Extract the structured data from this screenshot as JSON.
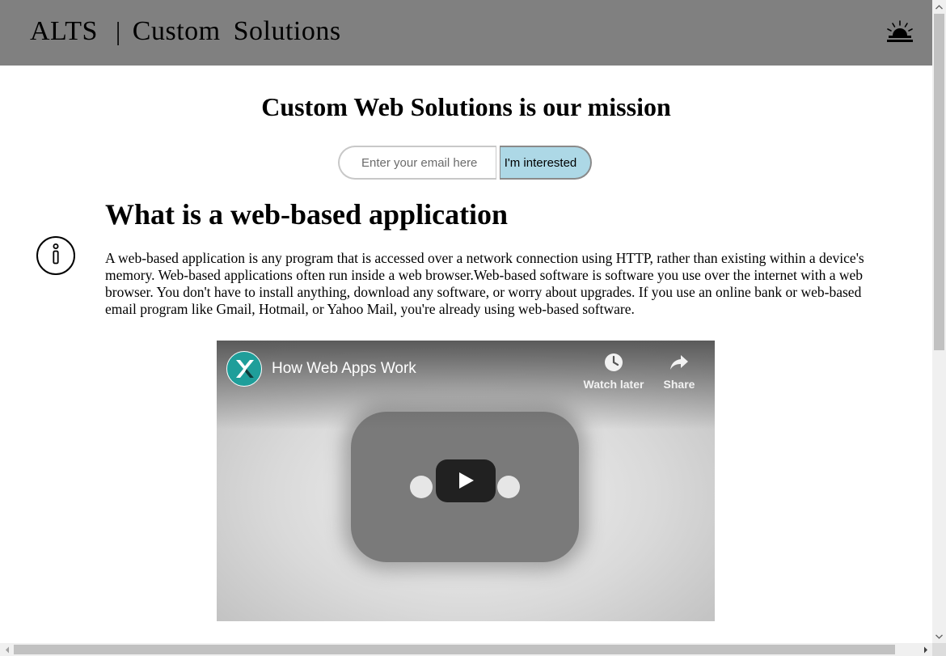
{
  "header": {
    "brand_name": "ALTS",
    "separator": "|",
    "brand_word1": "Custom",
    "brand_word2": "Solutions",
    "theme_toggle_icon": "sunset-icon"
  },
  "hero": {
    "title": "Custom Web Solutions is our mission",
    "email_placeholder": "Enter your email here",
    "email_value": "",
    "interest_button_label": "I'm interested",
    "button_color": "#add8e6"
  },
  "section": {
    "icon": "info-icon",
    "title": "What is a web-based application",
    "body": "A web-based application is any program that is accessed over a network connection using HTTP, rather than existing within a device's memory. Web-based applications often run inside a web browser.Web-based software is software you use over the internet with a web browser. You don't have to install anything, download any software, or worry about upgrades. If you use an online bank or web-based email program like Gmail, Hotmail, or Yahoo Mail, you're already using web-based software."
  },
  "video": {
    "title": "How Web Apps Work",
    "channel_icon": "channel-logo-icon",
    "watch_later_label": "Watch later",
    "share_label": "Share",
    "play_icon": "play-icon"
  },
  "colors": {
    "header_bg": "#808080",
    "accent": "#add8e6",
    "channel": "#1f9e9a"
  }
}
